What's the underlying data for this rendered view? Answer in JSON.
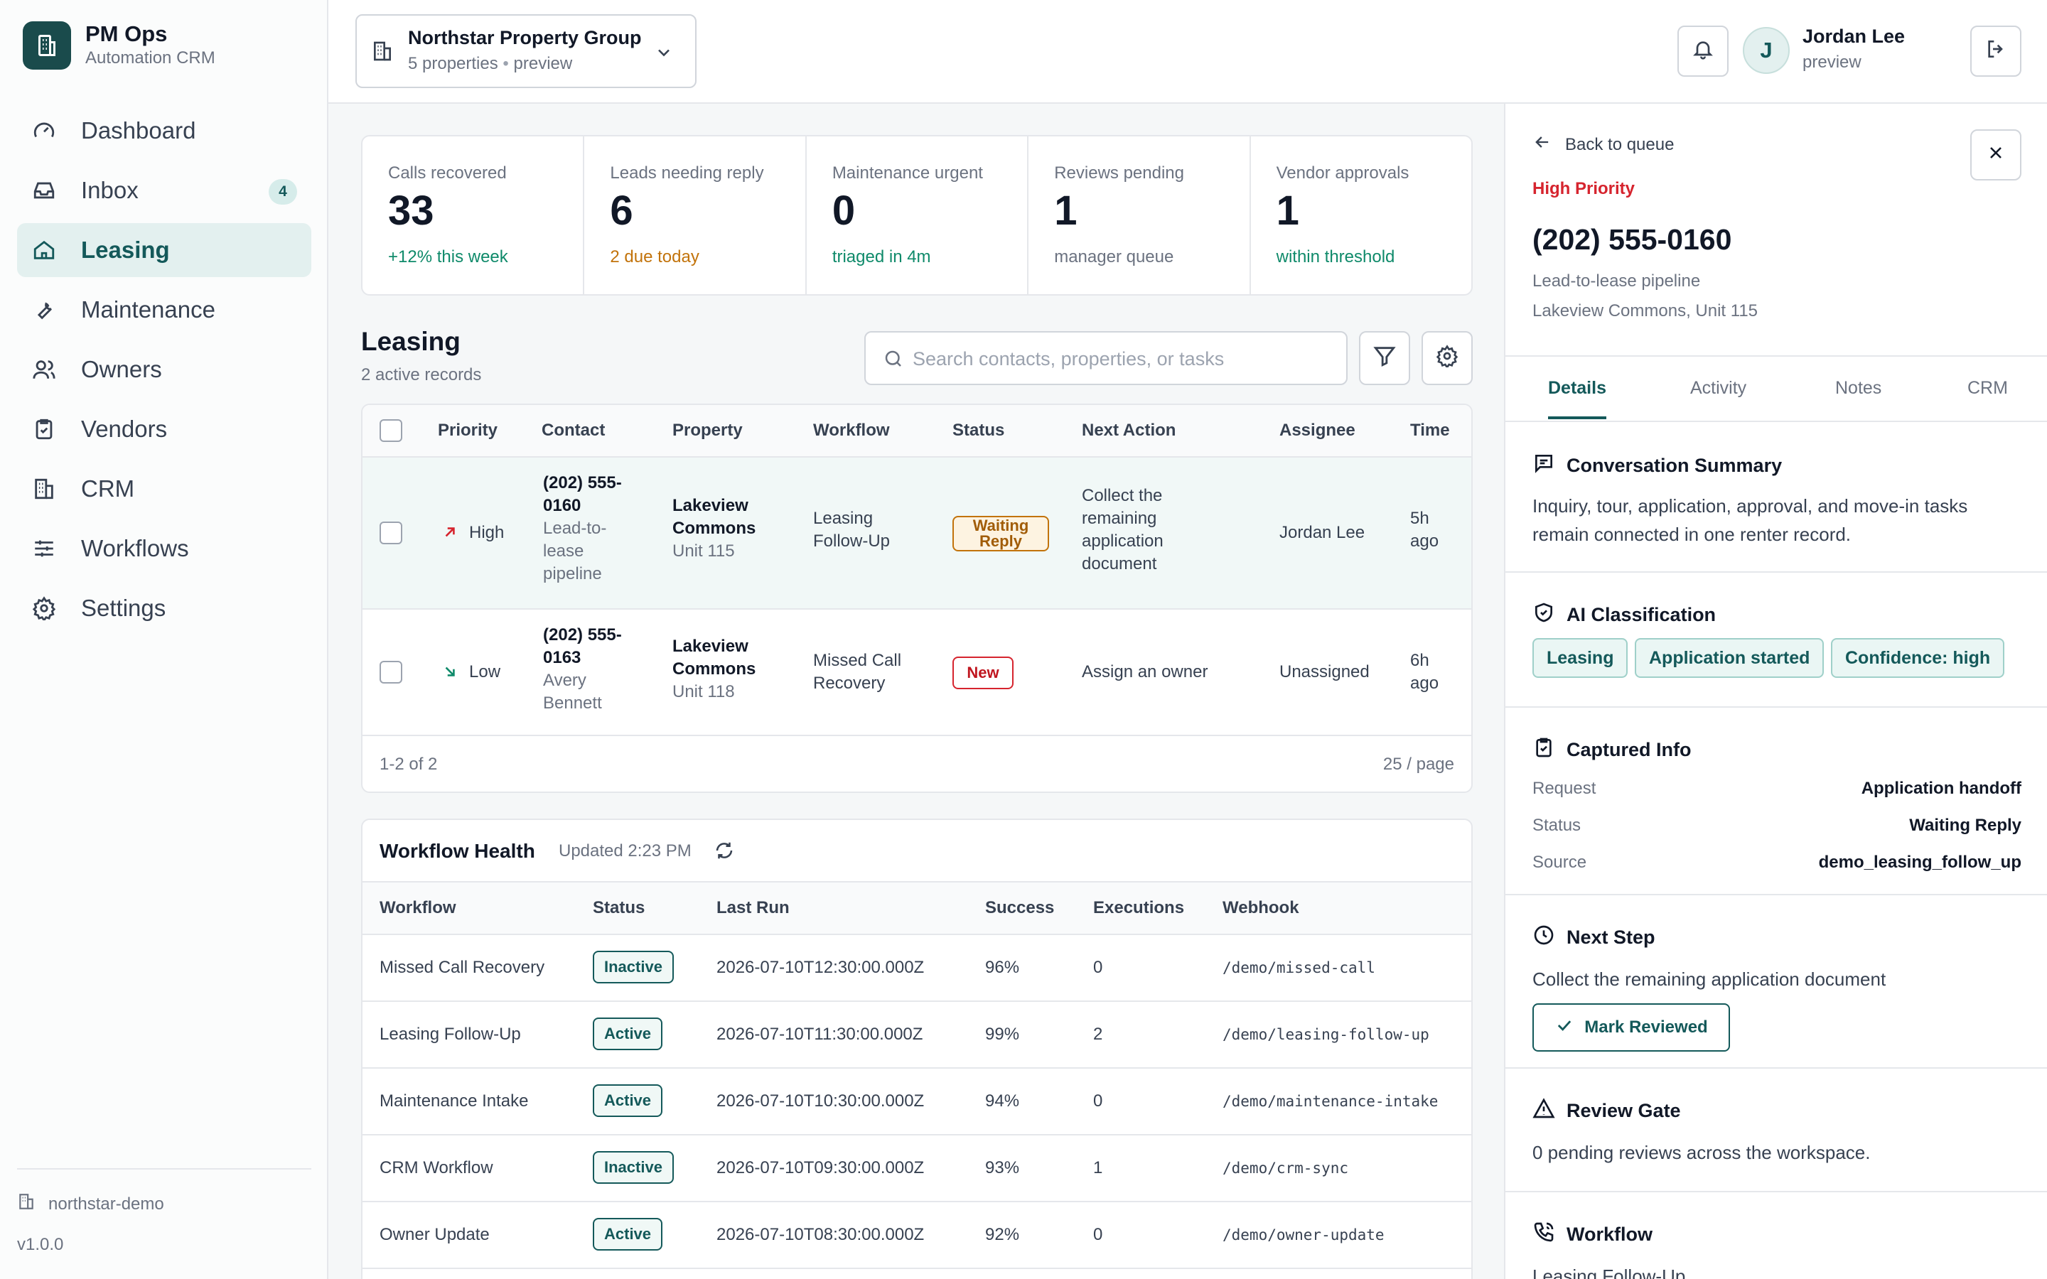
{
  "brand": {
    "title": "PM Ops",
    "subtitle": "Automation CRM"
  },
  "nav": [
    {
      "label": "Dashboard",
      "icon": "gauge-icon"
    },
    {
      "label": "Inbox",
      "icon": "inbox-icon",
      "badge": "4"
    },
    {
      "label": "Leasing",
      "icon": "home-icon",
      "active": true
    },
    {
      "label": "Maintenance",
      "icon": "wrench-icon"
    },
    {
      "label": "Owners",
      "icon": "users-icon"
    },
    {
      "label": "Vendors",
      "icon": "clipboard-check-icon"
    },
    {
      "label": "CRM",
      "icon": "building-icon"
    },
    {
      "label": "Workflows",
      "icon": "sliders-icon"
    },
    {
      "label": "Settings",
      "icon": "gear-icon"
    }
  ],
  "footer": {
    "workspace": "northstar-demo",
    "version": "v1.0.0"
  },
  "org": {
    "name": "Northstar Property Group",
    "properties": "5 properties",
    "mode": "preview"
  },
  "user": {
    "initial": "J",
    "name": "Jordan Lee",
    "mode": "preview"
  },
  "stats": [
    {
      "label": "Calls recovered",
      "value": "33",
      "sub": "+12% this week",
      "tone": "green"
    },
    {
      "label": "Leads needing reply",
      "value": "6",
      "sub": "2 due today",
      "tone": "amber"
    },
    {
      "label": "Maintenance urgent",
      "value": "0",
      "sub": "triaged in 4m",
      "tone": "green"
    },
    {
      "label": "Reviews pending",
      "value": "1",
      "sub": "manager queue",
      "tone": "gray"
    },
    {
      "label": "Vendor approvals",
      "value": "1",
      "sub": "within threshold",
      "tone": "green"
    }
  ],
  "leasing": {
    "title": "Leasing",
    "count": "2 active records",
    "search_placeholder": "Search contacts, properties, or tasks",
    "columns": [
      "Priority",
      "Contact",
      "Property",
      "Workflow",
      "Status",
      "Next Action",
      "Assignee",
      "Time"
    ],
    "rows": [
      {
        "priority": "High",
        "contact_1": "(202) 555-",
        "contact_2": "0160",
        "contact_sub_1": "Lead-to-",
        "contact_sub_2": "lease",
        "contact_sub_3": "pipeline",
        "property_1": "Lakeview",
        "property_2": "Commons",
        "unit": "Unit 115",
        "workflow_1": "Leasing",
        "workflow_2": "Follow-Up",
        "status": "Waiting Reply",
        "next_1": "Collect the",
        "next_2": "remaining",
        "next_3": "application",
        "next_4": "document",
        "assignee": "Jordan Lee",
        "time_1": "5h",
        "time_2": "ago"
      },
      {
        "priority": "Low",
        "contact_1": "(202) 555-",
        "contact_2": "0163",
        "contact_sub_1": "Avery",
        "contact_sub_2": "Bennett",
        "property_1": "Lakeview",
        "property_2": "Commons",
        "unit": "Unit 118",
        "workflow_1": "Missed Call",
        "workflow_2": "Recovery",
        "status": "New",
        "next_1": "Assign an owner",
        "assignee": "Unassigned",
        "time_1": "6h",
        "time_2": "ago"
      }
    ],
    "range": "1-2 of 2",
    "page_size": "25 / page"
  },
  "workflow_health": {
    "title": "Workflow Health",
    "updated": "Updated 2:23 PM",
    "columns": [
      "Workflow",
      "Status",
      "Last Run",
      "Success",
      "Executions",
      "Webhook"
    ],
    "rows": [
      {
        "name": "Missed Call Recovery",
        "status": "Inactive",
        "last_run": "2026-07-10T12:30:00.000Z",
        "success": "96%",
        "executions": "0",
        "webhook": "/demo/missed-call"
      },
      {
        "name": "Leasing Follow-Up",
        "status": "Active",
        "last_run": "2026-07-10T11:30:00.000Z",
        "success": "99%",
        "executions": "2",
        "webhook": "/demo/leasing-follow-up"
      },
      {
        "name": "Maintenance Intake",
        "status": "Active",
        "last_run": "2026-07-10T10:30:00.000Z",
        "success": "94%",
        "executions": "0",
        "webhook": "/demo/maintenance-intake"
      },
      {
        "name": "CRM Workflow",
        "status": "Inactive",
        "last_run": "2026-07-10T09:30:00.000Z",
        "success": "93%",
        "executions": "1",
        "webhook": "/demo/crm-sync"
      },
      {
        "name": "Owner Update",
        "status": "Active",
        "last_run": "2026-07-10T08:30:00.000Z",
        "success": "92%",
        "executions": "0",
        "webhook": "/demo/owner-update"
      }
    ]
  },
  "detail": {
    "back": "Back to queue",
    "priority": "High Priority",
    "phone": "(202) 555-0160",
    "pipeline": "Lead-to-lease pipeline",
    "location": "Lakeview Commons, Unit 115",
    "tabs": [
      "Details",
      "Activity",
      "Notes",
      "CRM"
    ],
    "summary_title": "Conversation Summary",
    "summary_1": "Inquiry, tour, application, approval, and move-in tasks",
    "summary_2": "remain connected in one renter record.",
    "ai_title": "AI Classification",
    "chips": [
      "Leasing",
      "Application started",
      "Confidence: high"
    ],
    "captured_title": "Captured Info",
    "captured": [
      {
        "key": "Request",
        "value": "Application handoff"
      },
      {
        "key": "Status",
        "value": "Waiting Reply"
      },
      {
        "key": "Source",
        "value": "demo_leasing_follow_up"
      }
    ],
    "next_title": "Next Step",
    "next_text": "Collect the remaining application document",
    "mark_label": "Mark Reviewed",
    "review_title": "Review Gate",
    "review_text": "0 pending reviews across the workspace.",
    "workflow_title": "Workflow",
    "workflow_text": "Leasing Follow-Up"
  },
  "colors": {
    "accent": "#14595a",
    "danger": "#d6242e",
    "warning": "#c2730b",
    "success": "#0f8a6a"
  }
}
